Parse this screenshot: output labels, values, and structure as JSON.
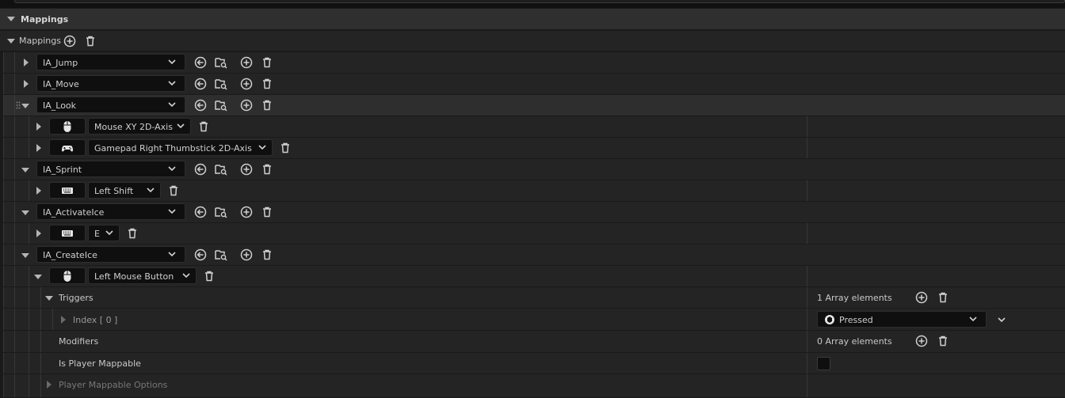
{
  "section": {
    "title": "Mappings"
  },
  "mappings_header": {
    "label": "Mappings"
  },
  "actions": [
    {
      "name": "IA_Jump",
      "expanded": false
    },
    {
      "name": "IA_Move",
      "expanded": false
    },
    {
      "name": "IA_Look",
      "expanded": true,
      "keys": [
        {
          "device": "mouse",
          "key": "Mouse XY 2D-Axis"
        },
        {
          "device": "gamepad",
          "key": "Gamepad Right Thumbstick 2D-Axis"
        }
      ]
    },
    {
      "name": "IA_Sprint",
      "expanded": true,
      "keys": [
        {
          "device": "keyboard",
          "key": "Left Shift"
        }
      ]
    },
    {
      "name": "IA_ActivateIce",
      "expanded": true,
      "keys": [
        {
          "device": "keyboard",
          "key": "E"
        }
      ]
    },
    {
      "name": "IA_CreateIce",
      "expanded": true,
      "keys": [
        {
          "device": "mouse",
          "key": "Left Mouse Button"
        }
      ]
    }
  ],
  "details": {
    "triggers_label": "Triggers",
    "triggers_count": "1 Array elements",
    "index_label": "Index [ 0 ]",
    "index_value": "Pressed",
    "modifiers_label": "Modifiers",
    "modifiers_count": "0 Array elements",
    "player_mappable_label": "Is Player Mappable",
    "player_mappable_checked": false,
    "player_mappable_options_label": "Player Mappable Options"
  },
  "icons": {
    "add": "add-circle-icon",
    "delete": "trash-icon",
    "use_selected": "arrow-left-circle-icon",
    "browse": "folder-search-icon",
    "chevron": "chevron-down-icon",
    "mouse": "mouse-icon",
    "gamepad": "gamepad-icon",
    "keyboard": "keyboard-icon",
    "trigger_pressed": "pressed-trigger-icon"
  },
  "colors": {
    "panel": "#242424",
    "header": "#2f2f2f",
    "field": "#0f0f0f",
    "highlight_row": "#2e2e2e"
  }
}
